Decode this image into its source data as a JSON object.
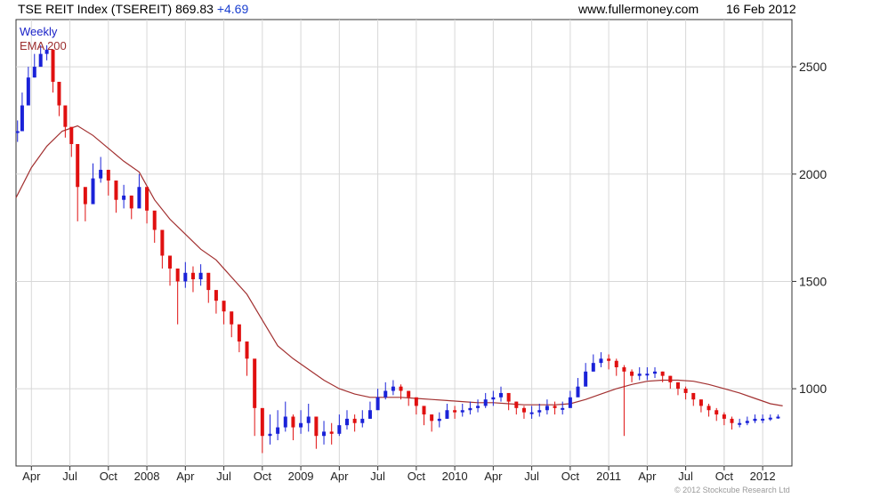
{
  "header": {
    "title": "TSE REIT Index (TSEREIT) 869.83",
    "change": "+4.69",
    "site": "www.fullermoney.com",
    "date": "16 Feb 2012"
  },
  "footer": {
    "copyright": "© 2012 Stockcube Research Ltd"
  },
  "colors": {
    "up": "#1a22d8",
    "down": "#e01010",
    "ema": "#a23030",
    "grid": "#d8d8d8",
    "axis": "#333333"
  },
  "chart_data": {
    "type": "line",
    "title": "TSE REIT Index (TSEREIT)",
    "frequency_label": "Weekly",
    "legend": [
      "Weekly",
      "EMA 200"
    ],
    "legend_position": "top-left",
    "grid": true,
    "y_axis_side": "right",
    "ylim": [
      640,
      2720
    ],
    "yticks": [
      1000,
      1500,
      2000,
      2500
    ],
    "xlim": [
      2007.15,
      2012.19
    ],
    "xticks": [
      {
        "label": "Apr",
        "x": 2007.25
      },
      {
        "label": "Jul",
        "x": 2007.5
      },
      {
        "label": "Oct",
        "x": 2007.75
      },
      {
        "label": "2008",
        "x": 2008.0
      },
      {
        "label": "Apr",
        "x": 2008.25
      },
      {
        "label": "Jul",
        "x": 2008.5
      },
      {
        "label": "Oct",
        "x": 2008.75
      },
      {
        "label": "2009",
        "x": 2009.0
      },
      {
        "label": "Apr",
        "x": 2009.25
      },
      {
        "label": "Jul",
        "x": 2009.5
      },
      {
        "label": "Oct",
        "x": 2009.75
      },
      {
        "label": "2010",
        "x": 2010.0
      },
      {
        "label": "Apr",
        "x": 2010.25
      },
      {
        "label": "Jul",
        "x": 2010.5
      },
      {
        "label": "Oct",
        "x": 2010.75
      },
      {
        "label": "2011",
        "x": 2011.0
      },
      {
        "label": "Apr",
        "x": 2011.25
      },
      {
        "label": "Jul",
        "x": 2011.5
      },
      {
        "label": "Oct",
        "x": 2011.75
      },
      {
        "label": "2012",
        "x": 2012.0
      }
    ],
    "series": [
      {
        "name": "Weekly",
        "style": "price-bars",
        "x": [
          2007.16,
          2007.19,
          2007.23,
          2007.27,
          2007.31,
          2007.35,
          2007.39,
          2007.43,
          2007.47,
          2007.51,
          2007.55,
          2007.6,
          2007.65,
          2007.7,
          2007.75,
          2007.8,
          2007.85,
          2007.9,
          2007.95,
          2008.0,
          2008.05,
          2008.1,
          2008.15,
          2008.2,
          2008.25,
          2008.3,
          2008.35,
          2008.4,
          2008.45,
          2008.5,
          2008.55,
          2008.6,
          2008.65,
          2008.7,
          2008.75,
          2008.8,
          2008.85,
          2008.9,
          2008.95,
          2009.0,
          2009.05,
          2009.1,
          2009.15,
          2009.2,
          2009.25,
          2009.3,
          2009.35,
          2009.4,
          2009.45,
          2009.5,
          2009.55,
          2009.6,
          2009.65,
          2009.7,
          2009.75,
          2009.8,
          2009.85,
          2009.9,
          2009.95,
          2010.0,
          2010.05,
          2010.1,
          2010.15,
          2010.2,
          2010.25,
          2010.3,
          2010.35,
          2010.4,
          2010.45,
          2010.5,
          2010.55,
          2010.6,
          2010.65,
          2010.7,
          2010.75,
          2010.8,
          2010.85,
          2010.9,
          2010.95,
          2011.0,
          2011.05,
          2011.1,
          2011.15,
          2011.2,
          2011.25,
          2011.3,
          2011.35,
          2011.4,
          2011.45,
          2011.5,
          2011.55,
          2011.6,
          2011.65,
          2011.7,
          2011.75,
          2011.8,
          2011.85,
          2011.9,
          2011.95,
          2012.0,
          2012.05,
          2012.1,
          2012.13
        ],
        "close": [
          2200,
          2320,
          2450,
          2500,
          2560,
          2580,
          2430,
          2320,
          2220,
          2140,
          1940,
          1860,
          1980,
          2020,
          1970,
          1880,
          1900,
          1840,
          1940,
          1830,
          1740,
          1620,
          1560,
          1500,
          1540,
          1510,
          1540,
          1460,
          1410,
          1360,
          1300,
          1220,
          1140,
          910,
          780,
          790,
          820,
          870,
          820,
          840,
          870,
          780,
          800,
          790,
          830,
          860,
          840,
          860,
          900,
          960,
          990,
          1010,
          990,
          960,
          920,
          880,
          850,
          860,
          900,
          890,
          900,
          910,
          920,
          950,
          960,
          980,
          940,
          910,
          890,
          890,
          900,
          920,
          910,
          910,
          960,
          1010,
          1080,
          1120,
          1140,
          1130,
          1100,
          1080,
          1060,
          1070,
          1070,
          1080,
          1060,
          1030,
          1000,
          980,
          950,
          920,
          900,
          880,
          860,
          840,
          840,
          850,
          860,
          860,
          865,
          869.83
        ],
        "high": [
          2250,
          2380,
          2500,
          2560,
          2600,
          2600,
          2470,
          2360,
          2260,
          2180,
          2000,
          1910,
          2050,
          2080,
          2020,
          1930,
          1950,
          1900,
          2000,
          1880,
          1790,
          1680,
          1610,
          1560,
          1590,
          1570,
          1580,
          1500,
          1450,
          1400,
          1340,
          1270,
          1190,
          960,
          820,
          880,
          900,
          940,
          880,
          900,
          930,
          830,
          850,
          840,
          880,
          900,
          880,
          900,
          940,
          1000,
          1030,
          1040,
          1020,
          990,
          950,
          910,
          880,
          890,
          930,
          920,
          930,
          940,
          950,
          980,
          990,
          1010,
          970,
          940,
          920,
          920,
          930,
          950,
          940,
          940,
          990,
          1050,
          1120,
          1160,
          1170,
          1160,
          1140,
          1110,
          1090,
          1100,
          1100,
          1100,
          1080,
          1060,
          1030,
          1010,
          980,
          950,
          930,
          910,
          890,
          870,
          860,
          870,
          880,
          880,
          880,
          880
        ],
        "low": [
          2150,
          2270,
          2400,
          2450,
          2510,
          2530,
          2380,
          2270,
          2170,
          2080,
          1780,
          1780,
          1900,
          1960,
          1900,
          1820,
          1840,
          1790,
          1870,
          1770,
          1680,
          1560,
          1480,
          1300,
          1470,
          1450,
          1480,
          1400,
          1350,
          1300,
          1240,
          1170,
          1060,
          780,
          700,
          740,
          760,
          800,
          760,
          790,
          800,
          720,
          740,
          740,
          780,
          810,
          800,
          820,
          860,
          920,
          950,
          970,
          950,
          920,
          880,
          830,
          800,
          820,
          860,
          860,
          870,
          880,
          890,
          910,
          920,
          940,
          900,
          880,
          860,
          860,
          870,
          880,
          880,
          880,
          920,
          970,
          1040,
          1080,
          1100,
          1090,
          1060,
          780,
          1030,
          1040,
          1040,
          1050,
          1030,
          1000,
          970,
          950,
          920,
          890,
          870,
          850,
          830,
          810,
          820,
          830,
          840,
          840,
          850,
          860
        ]
      },
      {
        "name": "EMA 200",
        "style": "line",
        "x": [
          2007.15,
          2007.25,
          2007.35,
          2007.45,
          2007.55,
          2007.65,
          2007.75,
          2007.85,
          2007.95,
          2008.05,
          2008.15,
          2008.25,
          2008.35,
          2008.45,
          2008.55,
          2008.65,
          2008.75,
          2008.85,
          2008.95,
          2009.05,
          2009.15,
          2009.25,
          2009.35,
          2009.45,
          2009.55,
          2009.65,
          2009.75,
          2009.85,
          2009.95,
          2010.05,
          2010.15,
          2010.25,
          2010.35,
          2010.45,
          2010.55,
          2010.65,
          2010.75,
          2010.85,
          2010.95,
          2011.05,
          2011.15,
          2011.25,
          2011.35,
          2011.45,
          2011.55,
          2011.65,
          2011.75,
          2011.85,
          2011.95,
          2012.05,
          2012.13
        ],
        "y": [
          1890,
          2030,
          2130,
          2200,
          2225,
          2180,
          2120,
          2060,
          2010,
          1880,
          1790,
          1720,
          1650,
          1600,
          1520,
          1440,
          1320,
          1200,
          1140,
          1090,
          1040,
          1000,
          975,
          960,
          960,
          960,
          955,
          950,
          945,
          940,
          935,
          935,
          930,
          925,
          925,
          925,
          930,
          950,
          975,
          1000,
          1020,
          1035,
          1040,
          1040,
          1035,
          1020,
          1000,
          980,
          955,
          930,
          920
        ]
      }
    ]
  }
}
